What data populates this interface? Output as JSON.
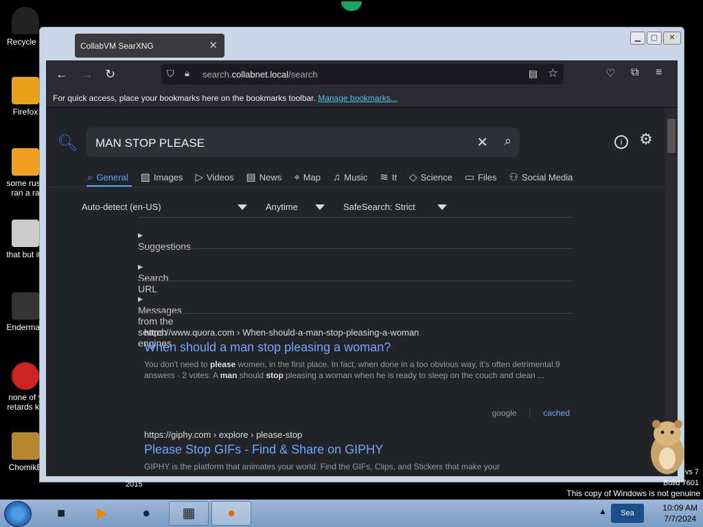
{
  "desktop": {
    "icons": [
      {
        "label": "Recycle B",
        "icon": "recycle-bin-icon"
      },
      {
        "label": "Firefox",
        "icon": "firefox-icon"
      },
      {
        "label": "some russ ran a ra",
        "icon": "file-icon"
      },
      {
        "label": "that but its",
        "icon": "folder-icon"
      },
      {
        "label": "Enderman",
        "icon": "window-icon"
      },
      {
        "label": "none of y retards kn",
        "icon": "red-icon"
      },
      {
        "label": "ChomikB",
        "icon": "hamster-icon"
      }
    ],
    "year_text": "2015",
    "build_line1": "vs 7",
    "build_line2": "Build 7601",
    "not_genuine": "This copy of Windows is not genuine"
  },
  "window": {
    "tab_title": "CollabVM SearXNG",
    "url_host_prefix": "search.",
    "url_host": "collabnet.local",
    "url_path": "/search",
    "bookmarks_text": "For quick access, place your bookmarks here on the bookmarks toolbar.",
    "bookmarks_link": "Manage bookmarks..."
  },
  "search": {
    "query": "MAN STOP PLEASE",
    "categories": [
      {
        "label": "General",
        "icon": "search-icon",
        "active": true
      },
      {
        "label": "Images",
        "icon": "image-icon"
      },
      {
        "label": "Videos",
        "icon": "play-icon"
      },
      {
        "label": "News",
        "icon": "news-icon"
      },
      {
        "label": "Map",
        "icon": "map-pin-icon"
      },
      {
        "label": "Music",
        "icon": "music-icon"
      },
      {
        "label": "It",
        "icon": "layers-icon"
      },
      {
        "label": "Science",
        "icon": "science-icon"
      },
      {
        "label": "Files",
        "icon": "files-icon"
      },
      {
        "label": "Social Media",
        "icon": "people-icon"
      }
    ],
    "filters": {
      "language": "Auto-detect (en-US)",
      "time": "Anytime",
      "safesearch": "SafeSearch: Strict"
    },
    "expanders": [
      "Suggestions",
      "Search URL",
      "Messages from the search engines"
    ],
    "results": [
      {
        "url": "https://www.quora.com",
        "path": "› When-should-a-man-stop-pleasing-a-woman",
        "title": "When should a man stop pleasing a woman?",
        "snippet_html": "You don't need to <b>please</b> women, in the first place. In fact, when done in a too obvious way, it's often detrimental.9 answers · 2 votes: A <b>man</b> should <b>stop</b> pleasing a woman when he is ready to sleep on the couch and clean ...",
        "engine": "google",
        "cached": "cached"
      },
      {
        "url": "https://giphy.com",
        "path": "› explore › please-stop",
        "title": "Please Stop GIFs - Find & Share on GIPHY",
        "snippet_html": "GIPHY is the platform that animates your world. Find the GIFs, Clips, and Stickers that make your"
      }
    ]
  },
  "taskbar": {
    "time": "10:09 AM",
    "date": "7/7/2024",
    "tray_label": "Sea"
  }
}
